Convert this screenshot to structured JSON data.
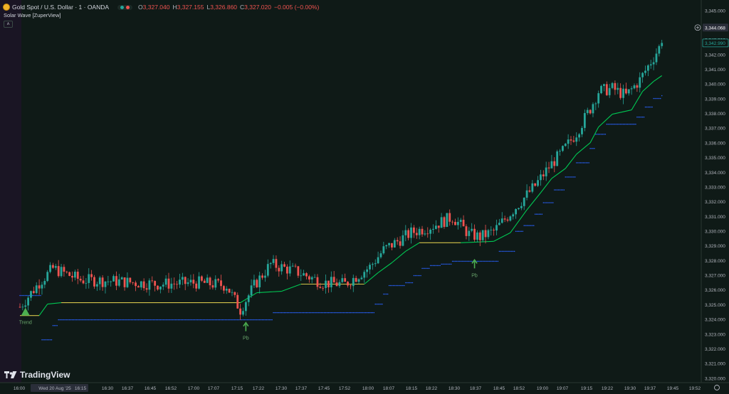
{
  "header": {
    "symbol": "Gold Spot / U.S. Dollar · 1 · OANDA",
    "o_label": "O",
    "o": "3,327.040",
    "h_label": "H",
    "h": "3,327.155",
    "l_label": "L",
    "l": "3,326.860",
    "c_label": "C",
    "c": "3,327.020",
    "change": "−0.005 (−0.00%)"
  },
  "indicator": {
    "name": "Solar Wave [ZuperView]"
  },
  "brand": {
    "name": "TradingView"
  },
  "colors": {
    "background": "#0f1a17",
    "up": "#26a69a",
    "down": "#ef5350",
    "wave_line": "#00c853",
    "flat_line": "#d4c44a",
    "stop_dots": "#2962ff",
    "signal": "#4caf50"
  },
  "chart_data": {
    "type": "candlestick",
    "price_labels": [
      "3,345.000",
      "3,344.000",
      "3,343.000",
      "3,342.000",
      "3,341.000",
      "3,340.000",
      "3,339.000",
      "3,338.000",
      "3,337.000",
      "3,336.000",
      "3,335.000",
      "3,334.000",
      "3,333.000",
      "3,332.000",
      "3,331.000",
      "3,330.000",
      "3,329.000",
      "3,328.000",
      "3,327.000",
      "3,326.000",
      "3,325.000",
      "3,324.000",
      "3,323.000",
      "3,322.000",
      "3,321.000",
      "3,320.000"
    ],
    "time_labels": [
      "16:00",
      "Wed 20 Aug '25",
      "16:15",
      "16:30",
      "16:37",
      "16:45",
      "16:52",
      "17:00",
      "17:07",
      "17:15",
      "17:22",
      "17:30",
      "17:37",
      "17:45",
      "17:52",
      "18:00",
      "18:07",
      "18:15",
      "18:22",
      "18:30",
      "18:37",
      "18:45",
      "18:52",
      "19:00",
      "19:07",
      "19:15",
      "19:22",
      "19:30",
      "19:37",
      "19:45",
      "19:52"
    ],
    "ylim": [
      3319.5,
      3345.6
    ],
    "crosshair_price": "3,344.068",
    "last_price": "3,342.990",
    "anchors": [
      [
        "16:00",
        3324.5
      ],
      [
        "16:07",
        3326.2
      ],
      [
        "16:12",
        3327.2
      ],
      [
        "16:22",
        3326.4
      ],
      [
        "16:35",
        3326.3
      ],
      [
        "16:50",
        3326.1
      ],
      [
        "17:05",
        3326.2
      ],
      [
        "17:15",
        3326.0
      ],
      [
        "17:20",
        3324.3
      ],
      [
        "17:25",
        3326.0
      ],
      [
        "17:31",
        3327.5
      ],
      [
        "17:40",
        3327.0
      ],
      [
        "17:50",
        3326.2
      ],
      [
        "17:58",
        3326.1
      ],
      [
        "18:07",
        3327.3
      ],
      [
        "18:12",
        3328.5
      ],
      [
        "18:22",
        3329.7
      ],
      [
        "18:30",
        3330.2
      ],
      [
        "18:37",
        3330.8
      ],
      [
        "18:43",
        3329.6
      ],
      [
        "18:47",
        3329.4
      ],
      [
        "18:52",
        3329.8
      ],
      [
        "19:00",
        3331.5
      ],
      [
        "19:07",
        3333.0
      ],
      [
        "19:12",
        3334.3
      ],
      [
        "19:17",
        3335.4
      ],
      [
        "19:22",
        3336.7
      ],
      [
        "19:27",
        3338.4
      ],
      [
        "19:30",
        3339.6
      ],
      [
        "19:35",
        3339.8
      ],
      [
        "19:40",
        3339.3
      ],
      [
        "19:45",
        3340.4
      ],
      [
        "19:50",
        3342.0
      ],
      [
        "19:53",
        3342.99
      ]
    ],
    "wave_line": [
      [
        "16:00",
        3323.9
      ],
      [
        "16:07",
        3323.9
      ],
      [
        "16:10",
        3324.7
      ],
      [
        "16:15",
        3324.8
      ],
      [
        "17:20",
        3324.8
      ],
      [
        "17:26",
        3325.5
      ],
      [
        "17:35",
        3325.6
      ],
      [
        "17:42",
        3326.1
      ],
      [
        "18:05",
        3326.1
      ],
      [
        "18:10",
        3326.9
      ],
      [
        "18:15",
        3327.6
      ],
      [
        "18:20",
        3328.4
      ],
      [
        "18:25",
        3329.0
      ],
      [
        "18:40",
        3329.0
      ],
      [
        "18:52",
        3329.1
      ],
      [
        "18:58",
        3329.7
      ],
      [
        "19:04",
        3331.3
      ],
      [
        "19:09",
        3332.5
      ],
      [
        "19:13",
        3333.5
      ],
      [
        "19:18",
        3334.2
      ],
      [
        "19:22",
        3335.2
      ],
      [
        "19:27",
        3336.0
      ],
      [
        "19:30",
        3337.1
      ],
      [
        "19:35",
        3338.0
      ],
      [
        "19:42",
        3338.3
      ],
      [
        "19:46",
        3339.6
      ],
      [
        "19:50",
        3340.3
      ],
      [
        "19:53",
        3340.7
      ]
    ],
    "stop_dots": [
      [
        "16:00",
        3325.3
      ],
      [
        "16:07",
        3325.3
      ],
      [
        "16:08",
        3322.2
      ],
      [
        "16:11",
        3322.2
      ],
      [
        "16:12",
        3323.2
      ],
      [
        "16:14",
        3323.6
      ],
      [
        "17:31",
        3323.6
      ],
      [
        "17:32",
        3324.1
      ],
      [
        "18:08",
        3324.1
      ],
      [
        "18:09",
        3324.7
      ],
      [
        "18:12",
        3325.4
      ],
      [
        "18:14",
        3326.0
      ],
      [
        "18:20",
        3326.2
      ],
      [
        "18:23",
        3326.7
      ],
      [
        "18:26",
        3327.2
      ],
      [
        "18:29",
        3327.4
      ],
      [
        "18:33",
        3327.5
      ],
      [
        "18:37",
        3327.7
      ],
      [
        "18:52",
        3327.7
      ],
      [
        "18:54",
        3328.4
      ],
      [
        "19:00",
        3329.8
      ],
      [
        "19:03",
        3330.2
      ],
      [
        "19:07",
        3331.0
      ],
      [
        "19:10",
        3331.8
      ],
      [
        "19:14",
        3332.7
      ],
      [
        "19:18",
        3333.6
      ],
      [
        "19:22",
        3334.6
      ],
      [
        "19:27",
        3335.6
      ],
      [
        "19:29",
        3336.6
      ],
      [
        "19:33",
        3337.3
      ],
      [
        "19:40",
        3337.3
      ],
      [
        "19:44",
        3337.8
      ],
      [
        "19:47",
        3338.5
      ],
      [
        "19:50",
        3339.1
      ],
      [
        "19:53",
        3339.3
      ]
    ],
    "signals": [
      {
        "time": "16:02",
        "label": "Trend",
        "kind": "triangle",
        "price": 3324.2
      },
      {
        "time": "17:22",
        "label": "Pb",
        "kind": "arrow",
        "price": 3323.4
      },
      {
        "time": "18:45",
        "label": "Pb",
        "kind": "arrow",
        "price": 3327.8
      }
    ]
  }
}
